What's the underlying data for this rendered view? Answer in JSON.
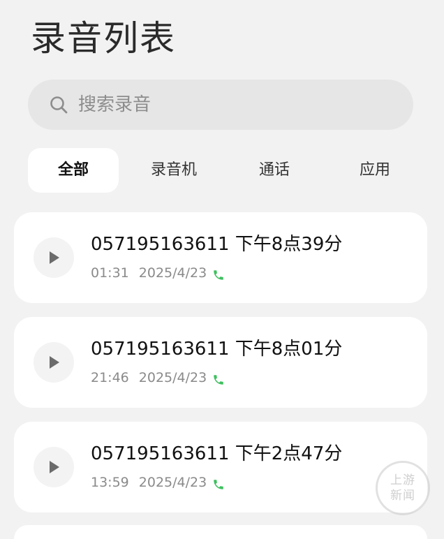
{
  "header": {
    "title": "录音列表"
  },
  "search": {
    "placeholder": "搜索录音",
    "icon": "search-icon"
  },
  "tabs": [
    {
      "label": "全部",
      "active": true
    },
    {
      "label": "录音机",
      "active": false
    },
    {
      "label": "通话",
      "active": false
    },
    {
      "label": "应用",
      "active": false
    }
  ],
  "recordings": [
    {
      "title": "057195163611 下午8点39分",
      "duration": "01:31",
      "date": "2025/4/23",
      "type_icon": "phone-icon"
    },
    {
      "title": "057195163611 下午8点01分",
      "duration": "21:46",
      "date": "2025/4/23",
      "type_icon": "phone-icon"
    },
    {
      "title": "057195163611 下午2点47分",
      "duration": "13:59",
      "date": "2025/4/23",
      "type_icon": "phone-icon"
    }
  ],
  "watermark": {
    "line1": "上游",
    "line2": "新闻"
  },
  "colors": {
    "accent_green": "#3fbf5f",
    "play_bg": "#f3f3f3",
    "card_bg": "#ffffff",
    "page_bg": "#f2f2f2"
  }
}
